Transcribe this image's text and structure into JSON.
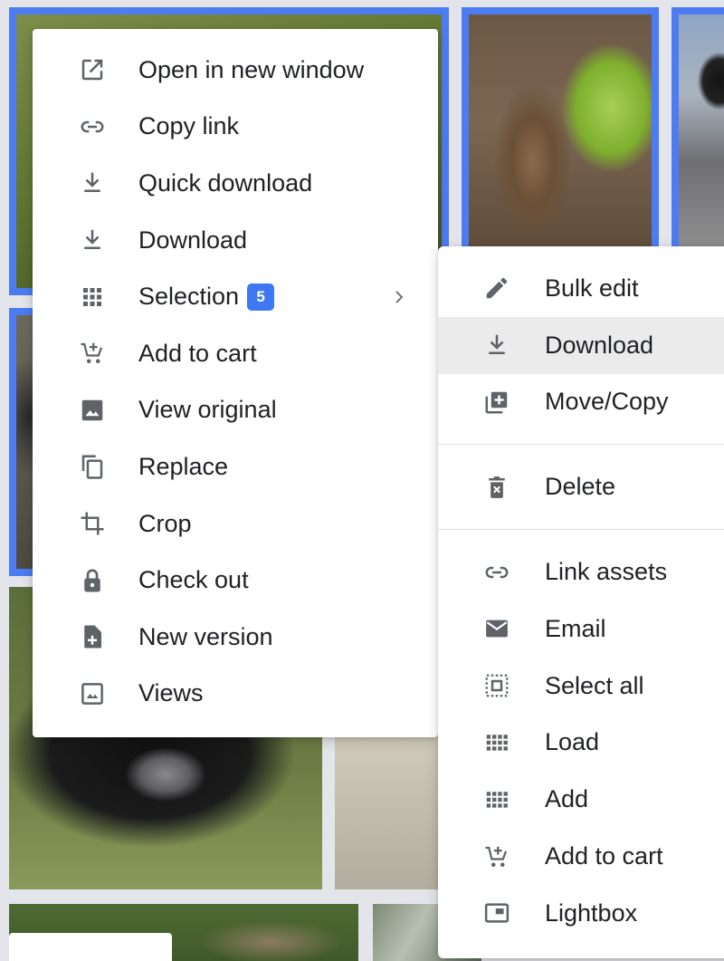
{
  "main_menu": {
    "items": [
      {
        "label": "Open in new window",
        "icon": "open-in-new-icon"
      },
      {
        "label": "Copy link",
        "icon": "link-icon"
      },
      {
        "label": "Quick download",
        "icon": "download-icon"
      },
      {
        "label": "Download",
        "icon": "download-icon"
      },
      {
        "label": "Selection",
        "icon": "grid-icon",
        "badge": "5",
        "has_submenu": true
      },
      {
        "label": "Add to cart",
        "icon": "add-to-cart-icon"
      },
      {
        "label": "View original",
        "icon": "image-icon"
      },
      {
        "label": "Replace",
        "icon": "copy-icon"
      },
      {
        "label": "Crop",
        "icon": "crop-icon"
      },
      {
        "label": "Check out",
        "icon": "lock-icon"
      },
      {
        "label": "New version",
        "icon": "file-add-icon"
      },
      {
        "label": "Views",
        "icon": "photo-icon"
      }
    ]
  },
  "selection_submenu": {
    "items": [
      {
        "label": "Bulk edit",
        "icon": "pencil-icon"
      },
      {
        "label": "Download",
        "icon": "download-icon",
        "highlighted": true
      },
      {
        "label": "Move/Copy",
        "icon": "library-add-icon"
      },
      {
        "label": "Delete",
        "icon": "delete-icon"
      },
      {
        "label": "Link assets",
        "icon": "link-icon"
      },
      {
        "label": "Email",
        "icon": "mail-icon"
      },
      {
        "label": "Select all",
        "icon": "select-all-icon"
      },
      {
        "label": "Load",
        "icon": "grid-icon"
      },
      {
        "label": "Add",
        "icon": "grid-icon"
      },
      {
        "label": "Add to cart",
        "icon": "add-to-cart-icon"
      },
      {
        "label": "Lightbox",
        "icon": "lightbox-icon"
      }
    ]
  },
  "colors": {
    "selection_border": "#4d7cf2",
    "badge": "#3d78f2",
    "highlight_row": "#ebebeb",
    "icon": "#5f6368",
    "text": "#202124"
  }
}
